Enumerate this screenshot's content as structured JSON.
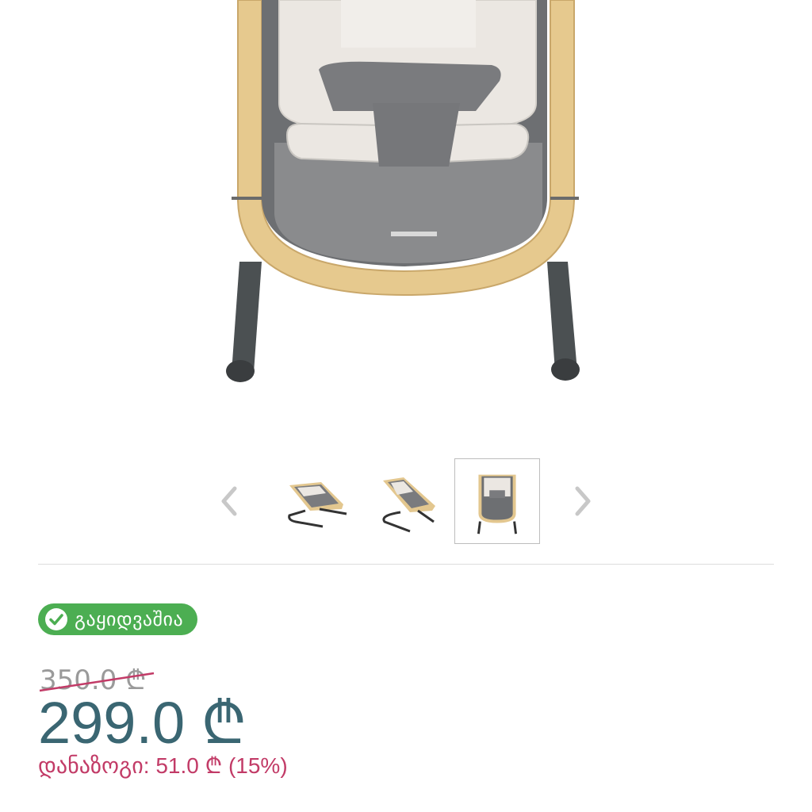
{
  "gallery": {
    "product_image_icon": "baby-bouncer-product-image",
    "prev_icon": "chevron-left-icon",
    "next_icon": "chevron-right-icon",
    "thumbnails": [
      {
        "icon": "bouncer-side-view-thumbnail",
        "selected": false
      },
      {
        "icon": "bouncer-angle-view-thumbnail",
        "selected": false
      },
      {
        "icon": "bouncer-front-view-thumbnail",
        "selected": true
      }
    ]
  },
  "product": {
    "availability": {
      "label": "გაყიდვაშია",
      "icon": "check-circle-icon",
      "color": "#4cae52"
    },
    "old_price": "350.0 ₾",
    "price": "299.0 ₾",
    "discount": "დანაზოგი: 51.0 ₾ (15%)",
    "colors": {
      "price": "#3a6672",
      "discount": "#c23b67",
      "old_price": "#9a9a9a"
    }
  }
}
